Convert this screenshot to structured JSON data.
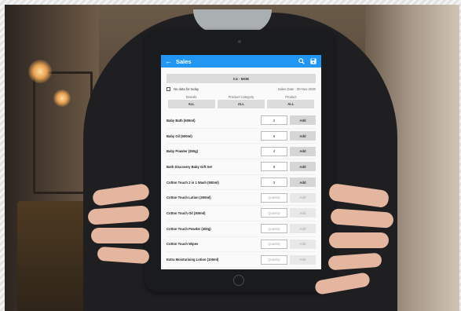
{
  "colors": {
    "appbar": "#2196f3",
    "button_gray": "#dcdcdc"
  },
  "app": {
    "title": "Sales",
    "icons": [
      "back-arrow-icon",
      "search-icon",
      "save-icon"
    ]
  },
  "store_button": "C4 - MOE",
  "no_data_label": "No data for today",
  "sales_date": "Sales Date : 30-Nov-2020",
  "filters": [
    {
      "label": "Brands",
      "value": "ALL"
    },
    {
      "label": "Product Category",
      "value": "ALL"
    },
    {
      "label": "Product",
      "value": "ALL"
    }
  ],
  "add_label": "Add",
  "quantity_placeholder": "Quantity",
  "products": [
    {
      "name": "Baby Bath (500ml)",
      "qty": "2"
    },
    {
      "name": "Baby Oil (500ml)",
      "qty": "5"
    },
    {
      "name": "Baby Powder (250g)",
      "qty": "4"
    },
    {
      "name": "Bath Discovery Baby Gift Set",
      "qty": "6"
    },
    {
      "name": "Cotton Touch 2 in 1 Wash (500ml)",
      "qty": "3"
    },
    {
      "name": "Cotton Touch Lotion (300ml)",
      "qty": ""
    },
    {
      "name": "Cotton Touch Oil (300ml)",
      "qty": ""
    },
    {
      "name": "Cotton Touch Powder (400g)",
      "qty": ""
    },
    {
      "name": "Cotton Touch Wipes",
      "qty": ""
    },
    {
      "name": "Extra Moisturising Lotion (100ml)",
      "qty": ""
    }
  ]
}
